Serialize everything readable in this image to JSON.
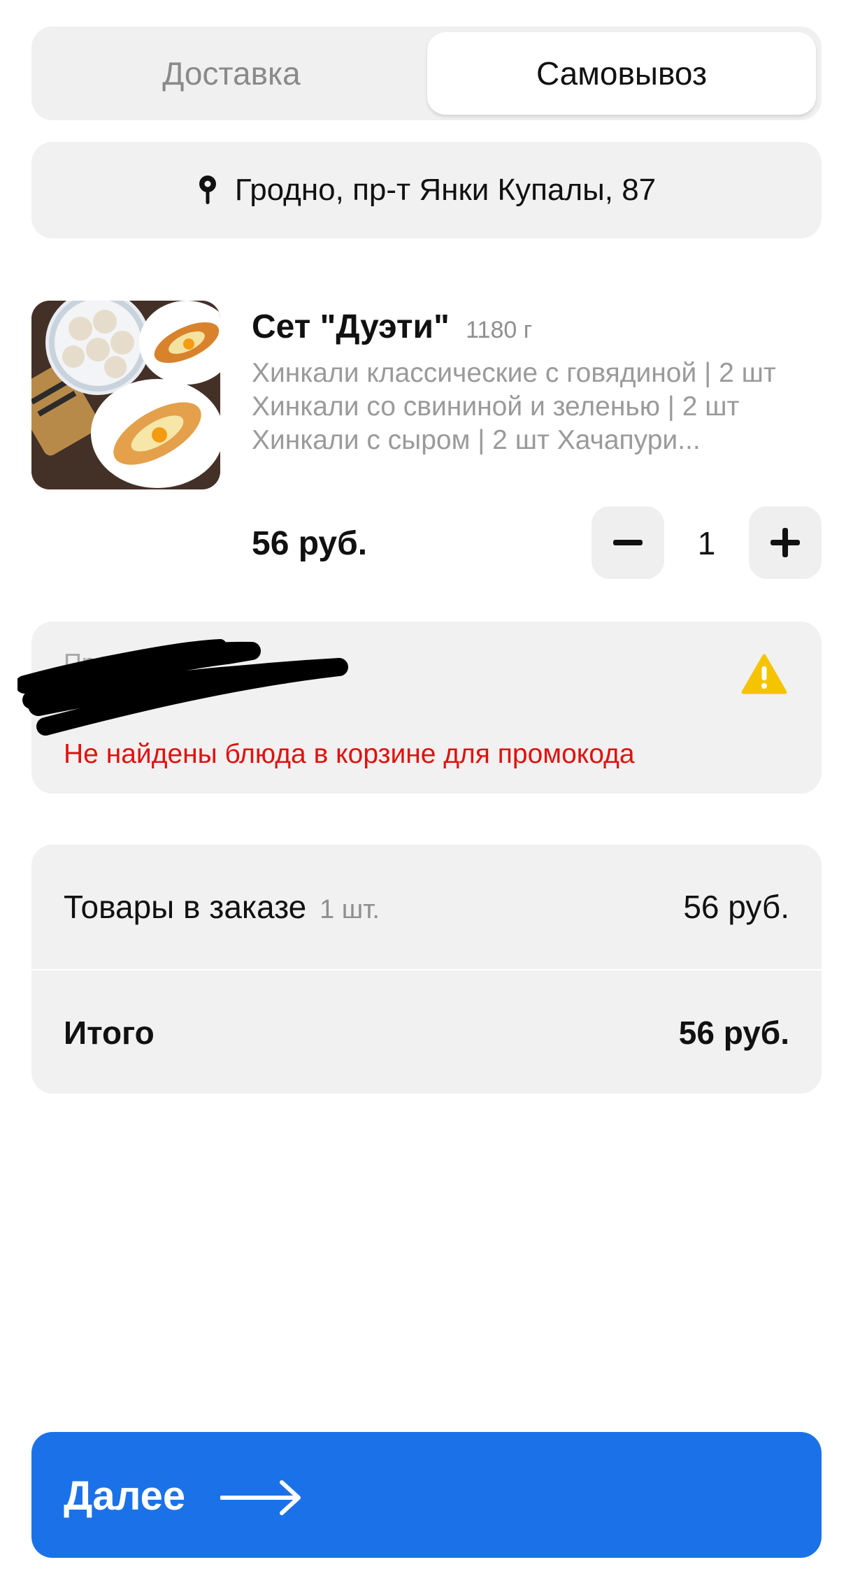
{
  "tabs": {
    "delivery": "Доставка",
    "pickup": "Самовывоз"
  },
  "address": {
    "text": "Гродно, пр-т Янки Купалы, 87",
    "icon": "map-pin-icon"
  },
  "product": {
    "title": "Сет \"Дуэти\"",
    "weight": "1180 г",
    "description": "Хинкали классические с говядиной | 2 шт Хинкали со свининой и зеленью | 2 шт Хинкали с сыром | 2 шт Хачапури...",
    "price": "56 руб.",
    "quantity": "1"
  },
  "promo": {
    "placeholder": "Промокод",
    "error": "Не найдены блюда в корзине для промокода",
    "error_color": "#e0110e",
    "warning_color": "#f5c400"
  },
  "summary": {
    "items_label": "Товары в заказе",
    "items_count": "1 шт.",
    "items_value": "56 руб.",
    "total_label": "Итого",
    "total_value": "56 руб."
  },
  "cta": {
    "label": "Далее",
    "color": "#1b72e8"
  }
}
